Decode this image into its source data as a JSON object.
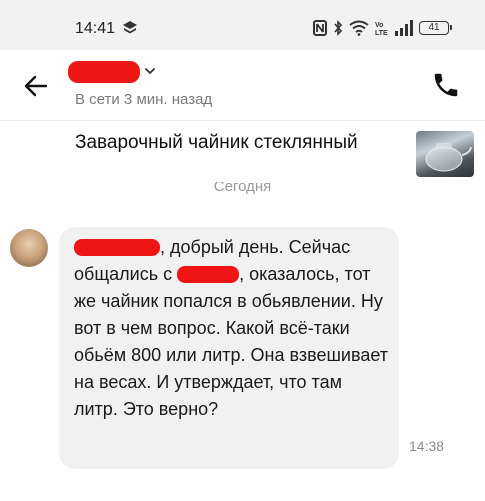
{
  "status_bar": {
    "time": "14:41",
    "battery": "41",
    "icons": [
      "app-notification-icon",
      "nfc-icon",
      "bluetooth-icon",
      "wifi-icon",
      "volte-icon",
      "signal-icon",
      "battery-icon"
    ]
  },
  "header": {
    "last_seen": "В сети 3 мин. назад"
  },
  "listing": {
    "title": "Заварочный чайник стеклянный"
  },
  "date_separator": "Сегодня",
  "message": {
    "part1": ", добрый день. Сейчас общались с ",
    "part2": ", оказалось, тот же чайник попался в обьявлении. Ну вот в чем вопрос. Какой всё-таки обьём 800 или литр. Она взвешивает на весах. И утверждает, что там литр. Это верно?",
    "time": "14:38"
  },
  "colors": {
    "redaction": "#ef1515",
    "bubble": "#f1f1f1",
    "status_bar_bg": "#f2f2f2"
  }
}
